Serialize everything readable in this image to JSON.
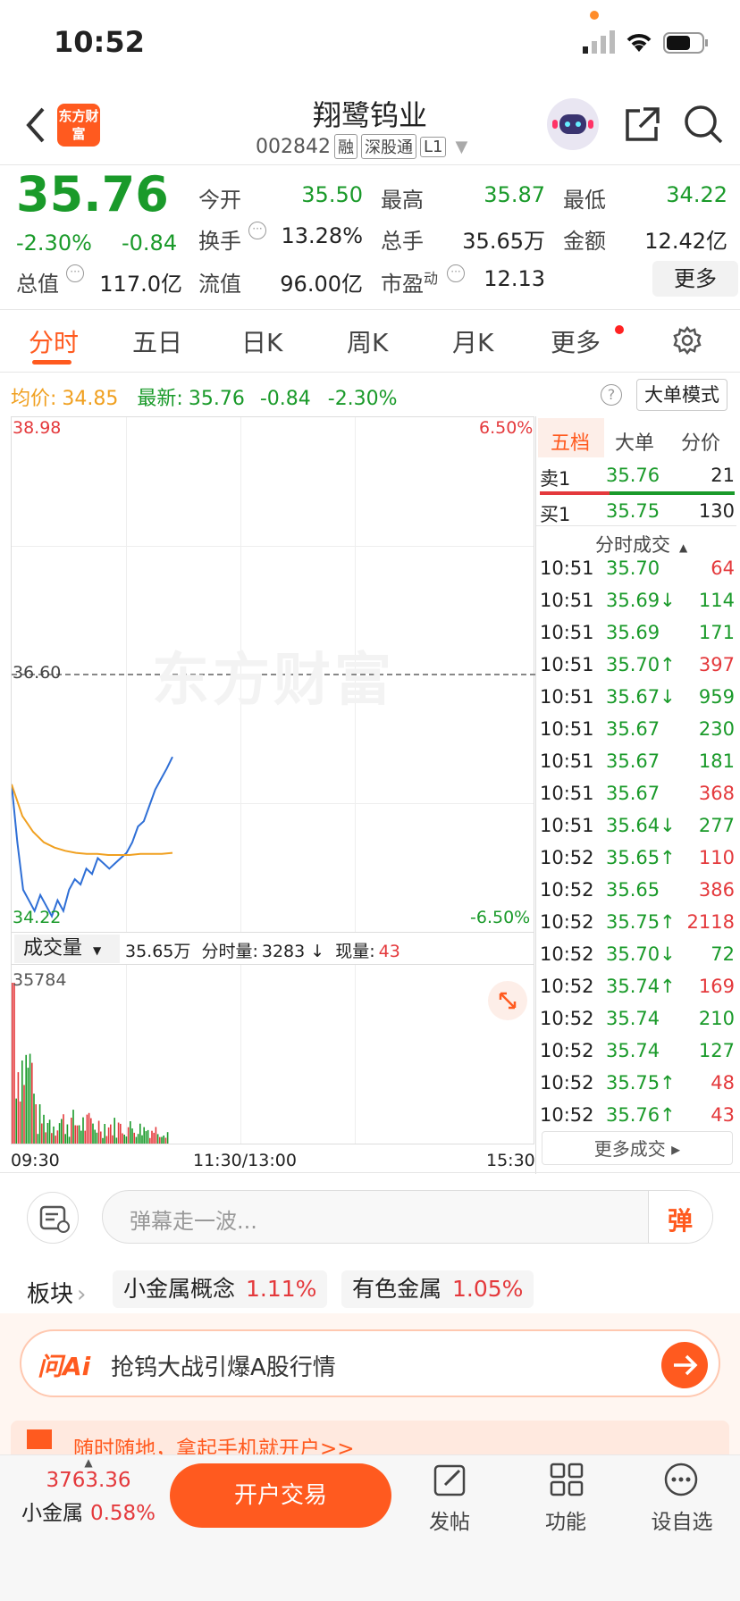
{
  "status": {
    "time": "10:52"
  },
  "header": {
    "title": "翔鹭钨业",
    "code": "002842",
    "tags": [
      "融",
      "深股通",
      "L1"
    ],
    "logo_text": "东方财富"
  },
  "quote": {
    "price": "35.76",
    "change_pct": "-2.30%",
    "change": "-0.84",
    "rows": [
      [
        {
          "label": "今开",
          "value": "35.50",
          "color": "green"
        },
        {
          "label": "最高",
          "value": "35.87",
          "color": "green"
        },
        {
          "label": "最低",
          "value": "34.22",
          "color": "green"
        }
      ],
      [
        {
          "label": "换手",
          "value": "13.28%",
          "color": "black"
        },
        {
          "label": "总手",
          "value": "35.65万",
          "color": "black"
        },
        {
          "label": "金额",
          "value": "12.42亿",
          "color": "black"
        }
      ]
    ],
    "row3": {
      "zongzhi_label": "总值",
      "zongzhi": "117.0亿",
      "liuzhi_label": "流值",
      "liuzhi": "96.00亿",
      "shiying_label": "市盈",
      "shiying_sup": "动",
      "shiying": "12.13"
    },
    "more": "更多"
  },
  "tabs": [
    "分时",
    "五日",
    "日K",
    "周K",
    "月K",
    "更多"
  ],
  "info_line": {
    "avg_label": "均价:",
    "avg": "34.85",
    "last_label": "最新:",
    "last": "35.76",
    "chg": "-0.84",
    "pct": "-2.30%",
    "mode_btn": "大单模式"
  },
  "chart": {
    "y_top": "38.98",
    "y_mid": "36.60",
    "y_bot": "34.22",
    "pct_top": "6.50%",
    "pct_bot": "-6.50%",
    "watermark": "东方财富",
    "vol_selector": "成交量",
    "vol_total": "35.65万",
    "fen_label": "分时量:",
    "fen_val": "3283 ↓",
    "cur_label": "现量:",
    "cur_val": "43",
    "vol_max": "35784",
    "x_labels": [
      "09:30",
      "11:30/13:00",
      "15:30"
    ]
  },
  "chart_data": {
    "type": "line",
    "ylim": [
      34.22,
      38.98
    ],
    "series": [
      {
        "values": [
          35.5,
          34.95,
          34.5,
          34.4,
          34.3,
          34.45,
          34.35,
          34.25,
          34.4,
          34.3,
          34.5,
          34.6,
          34.55,
          34.7,
          34.65,
          34.8,
          34.75,
          34.7,
          34.75,
          34.8,
          34.85,
          34.95,
          35.1,
          35.15,
          35.3,
          35.45,
          35.55,
          35.65,
          35.76
        ]
      },
      {
        "values": [
          35.5,
          35.2,
          35.05,
          34.95,
          34.9,
          34.87,
          34.85,
          34.84,
          34.84,
          34.83,
          34.83,
          34.83,
          34.84,
          34.84,
          34.84,
          34.85
        ]
      }
    ]
  },
  "right_panel": {
    "tabs": [
      "五档",
      "大单",
      "分价"
    ],
    "sell1": {
      "label": "卖1",
      "price": "35.76",
      "vol": "21"
    },
    "buy1": {
      "label": "买1",
      "price": "35.75",
      "vol": "130"
    },
    "ticks_title": "分时成交",
    "ticks": [
      {
        "t": "10:51",
        "p": "35.70",
        "v": "64",
        "c": "red"
      },
      {
        "t": "10:51",
        "p": "35.69↓",
        "v": "114",
        "c": "green"
      },
      {
        "t": "10:51",
        "p": "35.69",
        "v": "171",
        "c": "green"
      },
      {
        "t": "10:51",
        "p": "35.70↑",
        "v": "397",
        "c": "red"
      },
      {
        "t": "10:51",
        "p": "35.67↓",
        "v": "959",
        "c": "green"
      },
      {
        "t": "10:51",
        "p": "35.67",
        "v": "230",
        "c": "green"
      },
      {
        "t": "10:51",
        "p": "35.67",
        "v": "181",
        "c": "green"
      },
      {
        "t": "10:51",
        "p": "35.67",
        "v": "368",
        "c": "red"
      },
      {
        "t": "10:51",
        "p": "35.64↓",
        "v": "277",
        "c": "green"
      },
      {
        "t": "10:52",
        "p": "35.65↑",
        "v": "110",
        "c": "red"
      },
      {
        "t": "10:52",
        "p": "35.65",
        "v": "386",
        "c": "red"
      },
      {
        "t": "10:52",
        "p": "35.75↑",
        "v": "2118",
        "c": "red"
      },
      {
        "t": "10:52",
        "p": "35.70↓",
        "v": "72",
        "c": "green"
      },
      {
        "t": "10:52",
        "p": "35.74↑",
        "v": "169",
        "c": "red"
      },
      {
        "t": "10:52",
        "p": "35.74",
        "v": "210",
        "c": "green"
      },
      {
        "t": "10:52",
        "p": "35.74",
        "v": "127",
        "c": "green"
      },
      {
        "t": "10:52",
        "p": "35.75↑",
        "v": "48",
        "c": "red"
      },
      {
        "t": "10:52",
        "p": "35.76↑",
        "v": "43",
        "c": "red"
      }
    ],
    "more": "更多成交 ▸"
  },
  "danmu": {
    "placeholder": "弹幕走一波...",
    "btn": "弹"
  },
  "sectors": {
    "label": "板块",
    "items": [
      {
        "name": "小金属概念",
        "pct": "1.11%"
      },
      {
        "name": "有色金属",
        "pct": "1.05%"
      }
    ]
  },
  "ai": {
    "logo": "问Ai",
    "text": "抢钨大战引爆A股行情"
  },
  "banner": {
    "text": "随时随地，拿起手机就开户>>"
  },
  "bottom": {
    "index_val": "3763.36",
    "index_name": "小金属",
    "index_pct": "0.58%",
    "trade": "开户交易",
    "nav": [
      "发帖",
      "功能",
      "设自选"
    ]
  },
  "colors": {
    "accent": "#ff5a1f",
    "up": "#e4393c",
    "down": "#1a9a2a",
    "price_line": "#2f6fd6",
    "avg_line": "#f0a020"
  }
}
